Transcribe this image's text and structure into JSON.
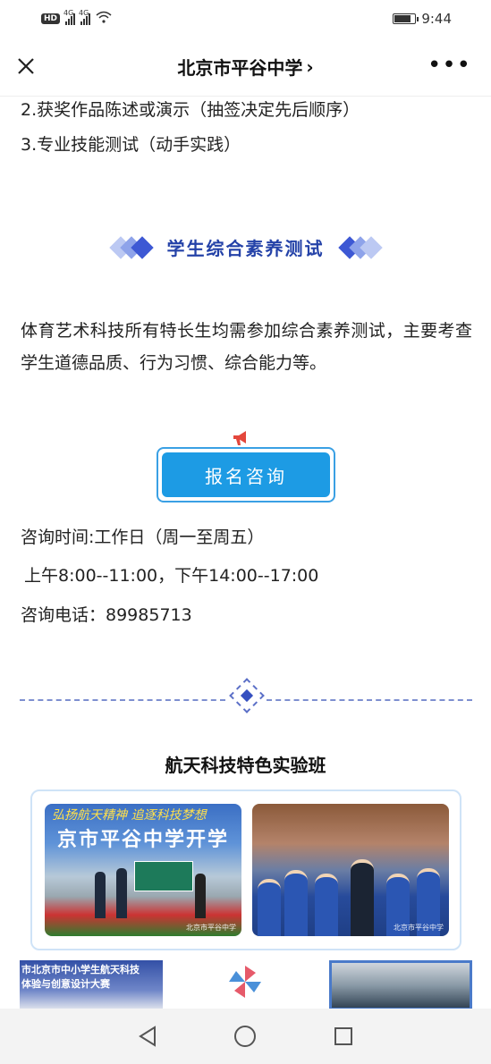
{
  "status": {
    "hd": "HD",
    "net1": "4G",
    "net2": "4G",
    "time": "9:44"
  },
  "nav": {
    "title": "北京市平谷中学",
    "chevron": "›",
    "close_icon": "close-icon",
    "more_icon": "more-icon"
  },
  "content": {
    "item2": "2.获奖作品陈述或演示（抽签决定先后顺序）",
    "item3": "3.专业技能测试（动手实践）",
    "section_title": "学生综合素养测试",
    "paragraph": "体育艺术科技所有特长生均需参加综合素养测试，主要考查学生道德品质、行为习惯、综合能力等。",
    "cta_label": "报名咨询",
    "consult_time": "咨询时间:工作日（周一至周五）",
    "consult_hours": "上午8:00--11:00，下午14:00--17:00",
    "consult_phone": "咨询电话：89985713",
    "sub_title": "航天科技特色实验班",
    "photo_a_banner_top": "弘扬航天精神  追逐科技梦想",
    "photo_a_banner_main": "京市平谷中学开学",
    "photo_watermark": "北京市平谷中学",
    "thumb_l_line1": "市北京市中小学生航天科技",
    "thumb_l_line2": "体验与创意设计大赛"
  },
  "colors": {
    "accent_blue": "#2442a8",
    "cta_blue": "#1d9be4",
    "diamond_colors": [
      "#9fb4f0",
      "#6f88e6",
      "#3d58d4"
    ]
  }
}
